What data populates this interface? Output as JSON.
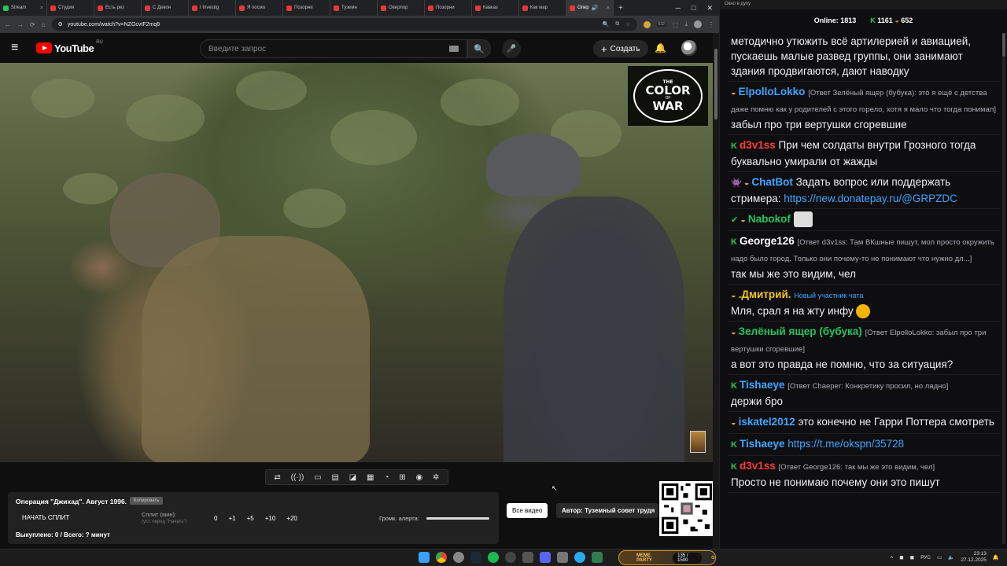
{
  "browser": {
    "tabs": [
      {
        "label": "Stream"
      },
      {
        "label": "Студия"
      },
      {
        "label": "Есть рез"
      },
      {
        "label": "С Девон"
      },
      {
        "label": "I Investig"
      },
      {
        "label": "Я посмо"
      },
      {
        "label": "Позорни"
      },
      {
        "label": "Туземн"
      },
      {
        "label": "Оверлор"
      },
      {
        "label": "Позорни"
      },
      {
        "label": "Кавказ"
      },
      {
        "label": "Как мар"
      },
      {
        "label": "Опер"
      }
    ],
    "url": "youtube.com/watch?v=NZGcvtF2mq8",
    "ext_badge": "632"
  },
  "youtube": {
    "logo_text": "YouTube",
    "region": "RU",
    "search_placeholder": "Введите запрос",
    "create_label": "Создать"
  },
  "video": {
    "watermark_line1": "THE",
    "watermark_line2": "COLOR",
    "watermark_line3": "OF",
    "watermark_line4": "WAR"
  },
  "controls": {
    "icons": [
      "loop-icon",
      "broadcast-icon",
      "cast-icon",
      "clip-icon",
      "pip-icon",
      "subtitles-icon",
      "speed-icon",
      "add-icon",
      "screenshot-icon",
      "settings-icon"
    ]
  },
  "panel": {
    "title": "Операция \"Джихад\". Август 1996.",
    "copy_label": "Копировать",
    "split_start": "НАЧАТЬ СПЛИТ",
    "split_label": "Сплит (мин):",
    "split_hint": "(уст. перед \"Начать\")",
    "split_buttons": [
      "0",
      "+1",
      "+5",
      "+10",
      "+20"
    ],
    "volume_label": "Громк. алерта:",
    "bought": "Выкуплено: 0 / Всего: ? минут",
    "all_videos": "Все видео",
    "author": "Автор: Туземный совет трудя"
  },
  "chat": {
    "window_title": "Окно в духу",
    "online_label": "Online:",
    "online_count": "1813",
    "k_count": "1161",
    "helm_count": "652",
    "messages": [
      {
        "text": "методично утюжить всё артилерией и авиацией, пускаешь малые развед группы, они занимают здания продвигаются, дают наводку"
      },
      {
        "name": "ElpolloLokko",
        "color": "#3ea6ff",
        "reply": "[Ответ Зелёный ящер (бубука): это я ещё с детства даже помню как у родителей с этого горело, хотя я мало что тогда понимал]",
        "text": "забыл про три вертушки сгоревшие"
      },
      {
        "name": "d3v1ss",
        "color": "#ff3b3b",
        "text": "При чем солдаты внутри Грозного тогда буквально умирали от жажды"
      },
      {
        "name": "ChatBot",
        "color": "#3ea6ff",
        "text": "Задать вопрос или поддержать стримера: ",
        "link": "https://new.donatepay.ru/@GRPZDC"
      },
      {
        "name": "Nabokof",
        "color": "#22c55e"
      },
      {
        "name": "George126",
        "color": "#ffffff",
        "reply": "[Ответ d3v1ss: Там ВКшные пишут, мол просто окружить надо было город. Только они почему-то не понимают что нужно дл...]",
        "text": "так мы же это видим, чел"
      },
      {
        "name": ".Дмитрий.",
        "color": "#f5c518",
        "tag": "Новый участник чата",
        "text": "Мля, срал я на жту инфу"
      },
      {
        "name": "Зелёный ящер (бубука)",
        "color": "#22c55e",
        "reply": "[Ответ ElpolloLokko: забыл про три вертушки сгоревшие]",
        "text": "а вот это правда не помню, что за ситуация?"
      },
      {
        "name": "Tishaeye",
        "color": "#3ea6ff",
        "reply": "[Ответ Chaeper: Конкретику просил, но ладно]",
        "text": "держи бро"
      },
      {
        "name": "iskatel2012",
        "color": "#3ea6ff",
        "text": "это конечно не Гарри Поттера смотреть"
      },
      {
        "name": "Tishaeye",
        "color": "#3ea6ff",
        "link": "https://t.me/okspn/35728"
      },
      {
        "name": "d3v1ss",
        "color": "#ff3b3b",
        "reply": "[Ответ George126: так мы же это видим, чел]",
        "text": "Просто не понимаю почему они это пишут"
      }
    ]
  },
  "taskbar": {
    "memeparty_label": "MEME PARTY",
    "memeparty_count": "135 / 1500",
    "lang": "РУС",
    "time": "23:13",
    "date": "27.12.2025"
  },
  "colors": {
    "chat_bg": "#0e0e10",
    "yt_bg": "#0f0f0f",
    "accent_red": "#ff0000",
    "k_green": "#22c55e",
    "link_blue": "#3ea6ff"
  }
}
